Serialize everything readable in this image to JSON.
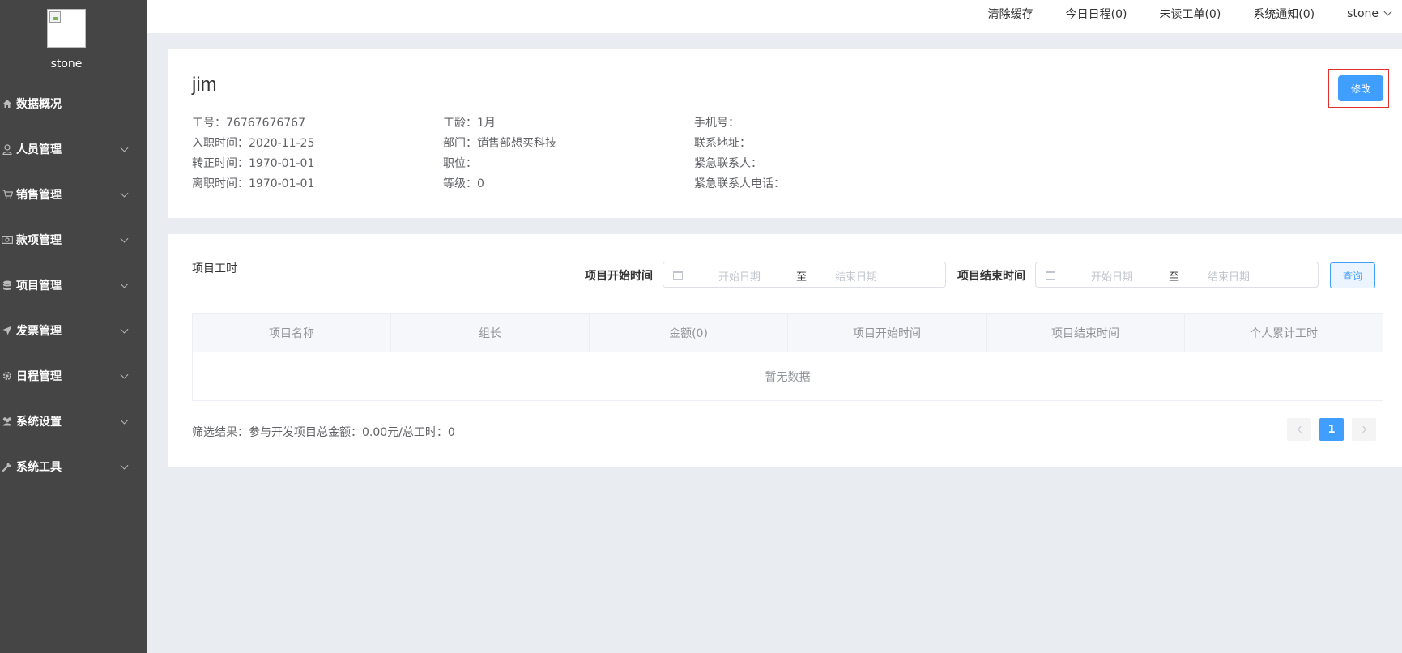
{
  "sidebar": {
    "username": "stone",
    "items": [
      {
        "label": "数据概况",
        "icon": "home-icon",
        "expandable": false
      },
      {
        "label": "人员管理",
        "icon": "user-icon",
        "expandable": true
      },
      {
        "label": "销售管理",
        "icon": "cart-icon",
        "expandable": true
      },
      {
        "label": "款项管理",
        "icon": "money-icon",
        "expandable": true
      },
      {
        "label": "项目管理",
        "icon": "database-icon",
        "expandable": true
      },
      {
        "label": "发票管理",
        "icon": "send-icon",
        "expandable": true
      },
      {
        "label": "日程管理",
        "icon": "gear-icon",
        "expandable": true
      },
      {
        "label": "系统设置",
        "icon": "users-icon",
        "expandable": true
      },
      {
        "label": "系统工具",
        "icon": "wrench-icon",
        "expandable": true
      }
    ]
  },
  "topbar": {
    "clear_cache": "清除缓存",
    "today_schedule": "今日日程(0)",
    "unread_tickets": "未读工单(0)",
    "system_notice": "系统通知(0)",
    "user": "stone"
  },
  "profile": {
    "name": "jim",
    "edit_label": "修改",
    "col1": [
      "工号：76767676767",
      "入职时间：2020-11-25",
      "转正时间：1970-01-01",
      "离职时间：1970-01-01"
    ],
    "col2": [
      "工龄：1月",
      "部门：销售部想买科技",
      "职位：",
      "等级：0"
    ],
    "col3": [
      "手机号：",
      "联系地址：",
      "紧急联系人：",
      "紧急联系人电话："
    ]
  },
  "projects": {
    "title": "项目工时",
    "start_filter_label": "项目开始时间",
    "end_filter_label": "项目结束时间",
    "start_placeholder": "开始日期",
    "end_placeholder": "结束日期",
    "range_sep": "至",
    "query_label": "查询",
    "columns": [
      "项目名称",
      "组长",
      "金额(0)",
      "项目开始时间",
      "项目结束时间",
      "个人累计工时"
    ],
    "empty_text": "暂无数据",
    "summary": "筛选结果：参与开发项目总金额：0.00元/总工时：0",
    "current_page": "1"
  },
  "colors": {
    "sidebar_bg": "#454545",
    "primary": "#409eff",
    "page_bg": "#e9edf2",
    "highlight_border": "#e0302b"
  }
}
